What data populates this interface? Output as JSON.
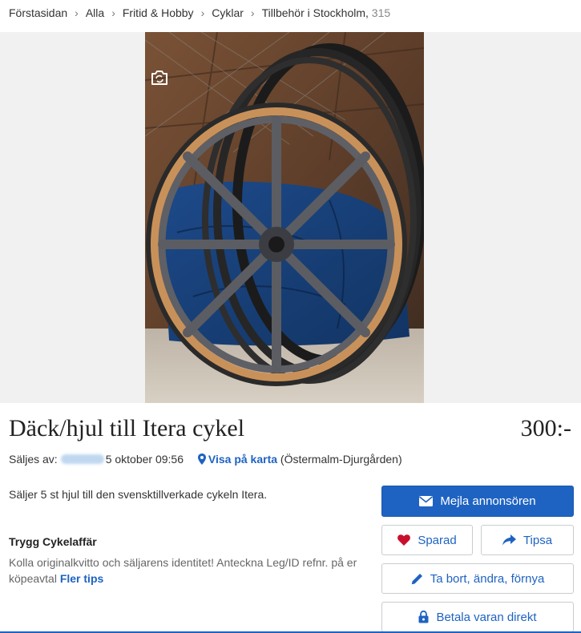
{
  "breadcrumb": {
    "items": [
      "Förstasidan",
      "Alla",
      "Fritid & Hobby",
      "Cyklar",
      "Tillbehör i Stockholm"
    ],
    "separator": "›",
    "count": "315"
  },
  "gallery": {
    "camera_icon": "camera-rotate-icon",
    "image_subject": "bicycle-wheel-photo"
  },
  "listing": {
    "title": "Däck/hjul till Itera cykel",
    "price": "300:-",
    "seller_prefix": "Säljes av:",
    "date": "5 oktober 09:56",
    "map_link": "Visa på karta",
    "location": "(Östermalm-Djurgården)",
    "description": "Säljer 5 st hjul till den svensktillverkade cykeln Itera."
  },
  "safety": {
    "title": "Trygg Cykelaffär",
    "text": "Kolla originalkvitto och säljarens identitet! Anteckna Leg/ID refnr. på er köpeavtal",
    "link": "Fler tips"
  },
  "actions": {
    "email": "Mejla annonsören",
    "saved": "Sparad",
    "share": "Tipsa",
    "edit": "Ta bort, ändra, förnya",
    "pay": "Betala varan direkt"
  },
  "colors": {
    "accent": "#1e63c2",
    "heart": "#c8102e"
  }
}
